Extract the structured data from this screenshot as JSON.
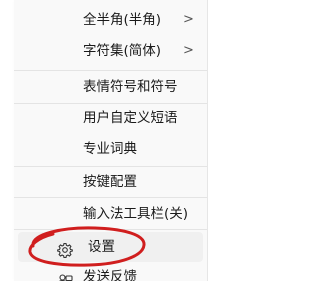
{
  "menu": {
    "items": [
      {
        "label": "全半角(半角)",
        "has_submenu": true
      },
      {
        "label": "字符集(简体)",
        "has_submenu": true
      },
      {
        "label": "表情符号和符号",
        "has_submenu": false
      },
      {
        "label": "用户自定义短语",
        "has_submenu": false
      },
      {
        "label": "专业词典",
        "has_submenu": false
      },
      {
        "label": "按键配置",
        "has_submenu": false
      },
      {
        "label": "输入法工具栏(关)",
        "has_submenu": false
      },
      {
        "label": "设置",
        "has_submenu": false,
        "icon": "gear-icon"
      },
      {
        "label": "发送反馈",
        "has_submenu": false,
        "icon": "feedback-icon"
      }
    ],
    "chevron": ">"
  },
  "annotation": {
    "color": "#d01e1e",
    "shape": "ellipse-circle",
    "target": "设置"
  },
  "colors": {
    "menu_background": "#f9f9f9",
    "hover_background": "#f0f0f0",
    "separator": "#e4e4e4",
    "text": "#1a1a1a"
  }
}
